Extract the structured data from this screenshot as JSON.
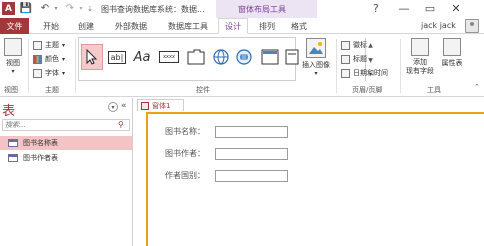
{
  "titlebar": {
    "doc_title": "图书查询数据库系统：数据...",
    "context_title": "窗体布局工具",
    "help": "?",
    "logo": "A",
    "minimize": "—",
    "restore": "▭",
    "close": "✕"
  },
  "tabs": {
    "file": "文件",
    "home": "开始",
    "create": "创建",
    "external": "外部数据",
    "dbtools": "数据库工具",
    "design": "设计",
    "arrange": "排列",
    "format": "格式"
  },
  "user": {
    "name": "jack jack"
  },
  "ribbon": {
    "views": {
      "btn": "视图",
      "group": "视图"
    },
    "themes": {
      "theme": "主题",
      "colors": "颜色",
      "fonts": "字体",
      "group": "主题"
    },
    "controls": {
      "group": "控件",
      "label_ab": "ab|",
      "label_aa": "Aa",
      "label_xxxx": "xxxx"
    },
    "insert_image": "插入图像",
    "header_footer": {
      "logo": "徽标",
      "title": "标题",
      "datetime": "日期和时间",
      "group": "页眉/页脚"
    },
    "tools": {
      "add_fields": "添加\n现有字段",
      "property_sheet": "属性表",
      "group": "工具"
    }
  },
  "nav": {
    "title": "表",
    "search_placeholder": "搜索...",
    "items": [
      {
        "label": "图书名称表",
        "selected": true
      },
      {
        "label": "图书作者表",
        "selected": false
      }
    ]
  },
  "document": {
    "tab_label": "窗体1",
    "fields": [
      {
        "label": "图书名称："
      },
      {
        "label": "图书作者："
      },
      {
        "label": "作者国别："
      }
    ]
  }
}
